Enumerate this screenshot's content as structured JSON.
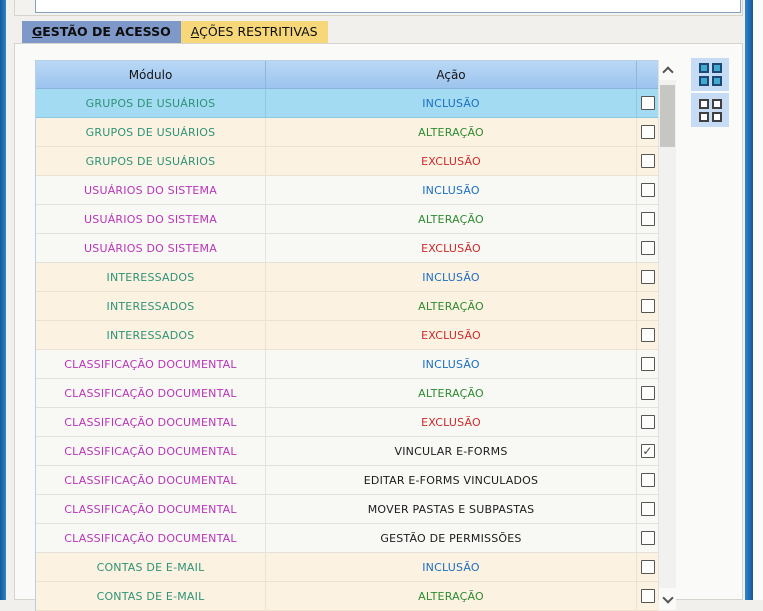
{
  "window": {
    "top_input_value": ""
  },
  "tabs": [
    {
      "first": "G",
      "rest": "ESTÃO DE ACESSO",
      "active": true
    },
    {
      "first": "A",
      "rest": "ÇÕES RESTRITIVAS",
      "active": false
    }
  ],
  "table": {
    "columns": {
      "module_label": "Módulo",
      "action_label": "Ação"
    },
    "check_glyph": "✓",
    "rows": [
      {
        "module": "GRUPOS DE USUÁRIOS",
        "module_color": "teal",
        "action": "INCLUSÃO",
        "action_color": "blue",
        "bg": "selected",
        "checked": false
      },
      {
        "module": "GRUPOS DE USUÁRIOS",
        "module_color": "teal",
        "action": "ALTERAÇÃO",
        "action_color": "green",
        "bg": "cream",
        "checked": false
      },
      {
        "module": "GRUPOS DE USUÁRIOS",
        "module_color": "teal",
        "action": "EXCLUSÃO",
        "action_color": "red",
        "bg": "cream",
        "checked": false
      },
      {
        "module": "USUÁRIOS DO SISTEMA",
        "module_color": "magenta",
        "action": "INCLUSÃO",
        "action_color": "blue",
        "bg": "plain",
        "checked": false
      },
      {
        "module": "USUÁRIOS DO SISTEMA",
        "module_color": "magenta",
        "action": "ALTERAÇÃO",
        "action_color": "green",
        "bg": "plain",
        "checked": false
      },
      {
        "module": "USUÁRIOS DO SISTEMA",
        "module_color": "magenta",
        "action": "EXCLUSÃO",
        "action_color": "red",
        "bg": "plain",
        "checked": false
      },
      {
        "module": "INTERESSADOS",
        "module_color": "teal",
        "action": "INCLUSÃO",
        "action_color": "blue",
        "bg": "cream",
        "checked": false
      },
      {
        "module": "INTERESSADOS",
        "module_color": "teal",
        "action": "ALTERAÇÃO",
        "action_color": "green",
        "bg": "cream",
        "checked": false
      },
      {
        "module": "INTERESSADOS",
        "module_color": "teal",
        "action": "EXCLUSÃO",
        "action_color": "red",
        "bg": "cream",
        "checked": false
      },
      {
        "module": "CLASSIFICAÇÃO DOCUMENTAL",
        "module_color": "magenta",
        "action": "INCLUSÃO",
        "action_color": "blue",
        "bg": "plain",
        "checked": false
      },
      {
        "module": "CLASSIFICAÇÃO DOCUMENTAL",
        "module_color": "magenta",
        "action": "ALTERAÇÃO",
        "action_color": "green",
        "bg": "plain",
        "checked": false
      },
      {
        "module": "CLASSIFICAÇÃO DOCUMENTAL",
        "module_color": "magenta",
        "action": "EXCLUSÃO",
        "action_color": "red",
        "bg": "plain",
        "checked": false
      },
      {
        "module": "CLASSIFICAÇÃO DOCUMENTAL",
        "module_color": "magenta",
        "action": "VINCULAR E-FORMS",
        "action_color": "black",
        "bg": "plain",
        "checked": true
      },
      {
        "module": "CLASSIFICAÇÃO DOCUMENTAL",
        "module_color": "magenta",
        "action": "EDITAR E-FORMS VINCULADOS",
        "action_color": "black",
        "bg": "plain",
        "checked": false
      },
      {
        "module": "CLASSIFICAÇÃO DOCUMENTAL",
        "module_color": "magenta",
        "action": "MOVER PASTAS E SUBPASTAS",
        "action_color": "black",
        "bg": "plain",
        "checked": false
      },
      {
        "module": "CLASSIFICAÇÃO DOCUMENTAL",
        "module_color": "magenta",
        "action": "GESTÃO DE PERMISSÕES",
        "action_color": "black",
        "bg": "plain",
        "checked": false
      },
      {
        "module": "CONTAS DE E-MAIL",
        "module_color": "teal",
        "action": "INCLUSÃO",
        "action_color": "blue",
        "bg": "cream",
        "checked": false
      },
      {
        "module": "CONTAS DE E-MAIL",
        "module_color": "teal",
        "action": "ALTERAÇÃO",
        "action_color": "green",
        "bg": "cream",
        "checked": false
      }
    ]
  },
  "colors": {
    "window_accent": "#1b6db5",
    "tab_active_bg": "#7e99c9",
    "tab_inactive_bg": "#f6d87b",
    "grid_header_bg": "#a9cdf0",
    "row_selected_bg": "#a3dbf3",
    "row_cream_bg": "#fcf2e2",
    "row_plain_bg": "#f8f8f5",
    "module_teal": "#2e9277",
    "module_magenta": "#b935b9",
    "action_blue": "#1b6ec2",
    "action_green": "#2e8b30",
    "action_red": "#cc2a2a",
    "action_black": "#1c1c1c"
  }
}
